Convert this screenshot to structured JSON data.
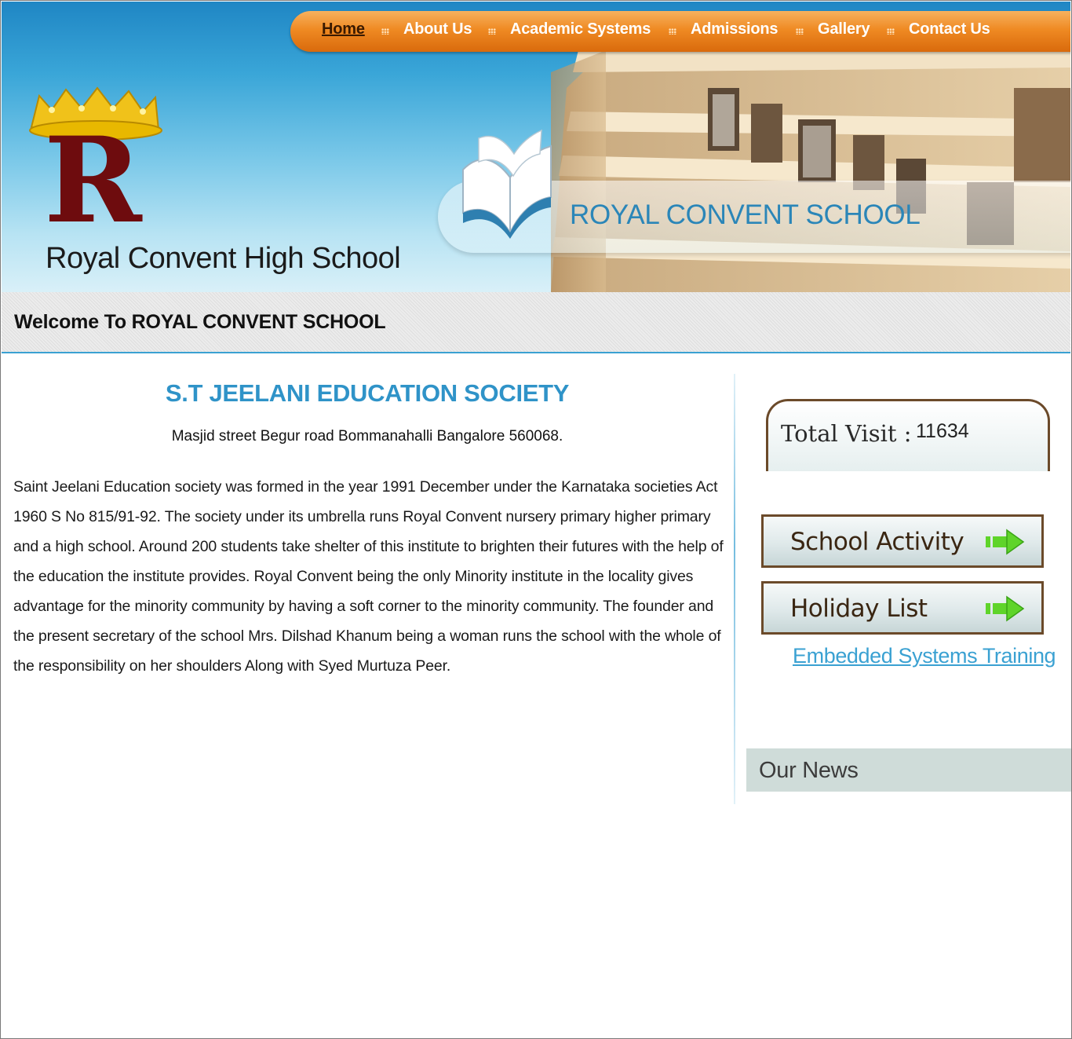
{
  "nav": {
    "items": [
      {
        "label": "Home",
        "active": true
      },
      {
        "label": "About Us"
      },
      {
        "label": "Academic Systems"
      },
      {
        "label": "Admissions"
      },
      {
        "label": "Gallery"
      },
      {
        "label": "Contact Us"
      }
    ]
  },
  "header": {
    "logo_letter": "R",
    "logo_name": "Royal Convent High School",
    "banner_title": "ROYAL CONVENT SCHOOL"
  },
  "welcome": {
    "text": "Welcome To ROYAL CONVENT SCHOOL"
  },
  "main": {
    "title": "S.T JEELANI EDUCATION SOCIETY",
    "address": "Masjid street Begur road Bommanahalli Bangalore 560068.",
    "body": "Saint Jeelani Education society was formed in the year 1991 December under the Karnataka societies Act 1960 S No 815/91-92. The society under its umbrella runs Royal Convent nursery primary higher primary and a high school. Around 200 students take shelter of this institute to brighten their futures with the help of the education the institute provides. Royal Convent being the only Minority institute in the locality gives advantage for the minority community by having a soft corner to the minority community. The founder and the present secretary of the school Mrs. Dilshad Khanum being a woman runs the school with the whole of the responsibility on her shoulders Along with Syed Murtuza Peer."
  },
  "sidebar": {
    "visit_label": "Total Visit :",
    "visit_count": "11634",
    "buttons": [
      {
        "label": "School Activity",
        "icon": "green-arrow-icon"
      },
      {
        "label": "Holiday List",
        "icon": "green-arrow-icon"
      }
    ],
    "link": "Embedded Systems Training",
    "news_title": "Our News"
  },
  "colors": {
    "nav_orange": "#ef8a23",
    "accent_blue": "#2f93c8",
    "border_brown": "#6b4a2a"
  }
}
